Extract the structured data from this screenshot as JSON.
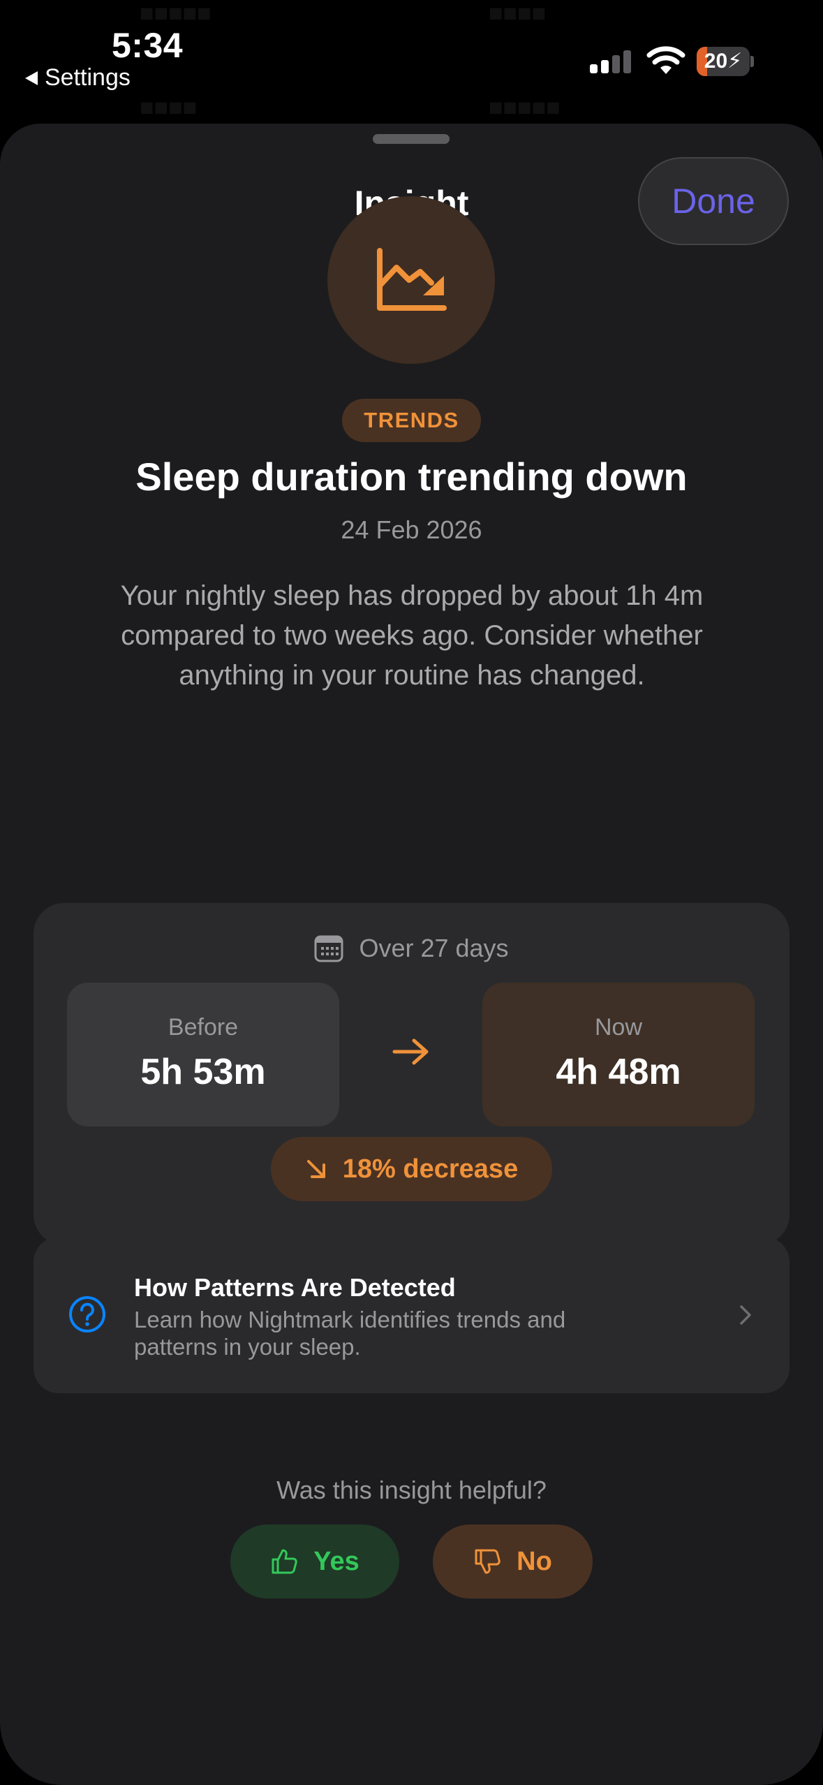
{
  "status_bar": {
    "time": "5:34",
    "back_label": "Settings",
    "battery_level": "20",
    "battery_fraction": 0.2,
    "charging": true
  },
  "sheet": {
    "title": "Insight",
    "done_label": "Done"
  },
  "insight": {
    "icon": "chart-trending-down-icon",
    "category": "TRENDS",
    "title": "Sleep duration trending down",
    "date": "24 Feb 2026",
    "description": "Your nightly sleep has dropped by about 1h 4m compared to two weeks ago. Consider whether anything in your routine has changed."
  },
  "comparison": {
    "period_label": "Over 27 days",
    "before_label": "Before",
    "before_value": "5h 53m",
    "now_label": "Now",
    "now_value": "4h 48m",
    "change_label": "18% decrease"
  },
  "info_link": {
    "title": "How Patterns Are Detected",
    "description": "Learn how Nightmark identifies trends and patterns in your sleep."
  },
  "feedback": {
    "question": "Was this insight helpful?",
    "yes_label": "Yes",
    "no_label": "No"
  },
  "colors": {
    "accent_orange": "#f0923a",
    "done_purple": "#6b63e8",
    "positive_green": "#33c85a",
    "info_blue": "#0a84ff",
    "sheet_background": "#1c1c1e",
    "card_background": "#2a2a2c"
  }
}
